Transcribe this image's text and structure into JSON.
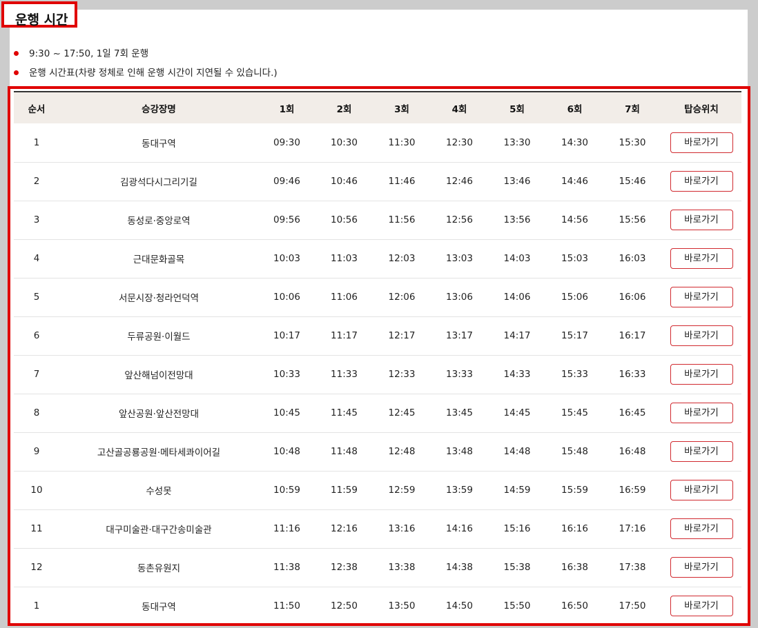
{
  "page_title": "운행 시간",
  "info": [
    "9:30 ~ 17:50, 1일 7회 운행",
    "운행 시간표(차량 정체로 인해 운행 시간이 지연될 수 있습니다.)"
  ],
  "colors": {
    "accent": "#e00000",
    "header_bg": "#f2ede8",
    "button_border": "#d0282e"
  },
  "table": {
    "headers": [
      "순서",
      "승강장명",
      "1회",
      "2회",
      "3회",
      "4회",
      "5회",
      "6회",
      "7회",
      "탑승위치"
    ],
    "button_label": "바로가기",
    "rows": [
      {
        "no": "1",
        "stop": "동대구역",
        "times": [
          "09:30",
          "10:30",
          "11:30",
          "12:30",
          "13:30",
          "14:30",
          "15:30"
        ]
      },
      {
        "no": "2",
        "stop": "김광석다시그리기길",
        "times": [
          "09:46",
          "10:46",
          "11:46",
          "12:46",
          "13:46",
          "14:46",
          "15:46"
        ]
      },
      {
        "no": "3",
        "stop": "동성로·중앙로역",
        "times": [
          "09:56",
          "10:56",
          "11:56",
          "12:56",
          "13:56",
          "14:56",
          "15:56"
        ]
      },
      {
        "no": "4",
        "stop": "근대문화골목",
        "times": [
          "10:03",
          "11:03",
          "12:03",
          "13:03",
          "14:03",
          "15:03",
          "16:03"
        ]
      },
      {
        "no": "5",
        "stop": "서문시장·청라언덕역",
        "times": [
          "10:06",
          "11:06",
          "12:06",
          "13:06",
          "14:06",
          "15:06",
          "16:06"
        ]
      },
      {
        "no": "6",
        "stop": "두류공원·이월드",
        "times": [
          "10:17",
          "11:17",
          "12:17",
          "13:17",
          "14:17",
          "15:17",
          "16:17"
        ]
      },
      {
        "no": "7",
        "stop": "앞산해넘이전망대",
        "times": [
          "10:33",
          "11:33",
          "12:33",
          "13:33",
          "14:33",
          "15:33",
          "16:33"
        ]
      },
      {
        "no": "8",
        "stop": "앞산공원·앞산전망대",
        "times": [
          "10:45",
          "11:45",
          "12:45",
          "13:45",
          "14:45",
          "15:45",
          "16:45"
        ]
      },
      {
        "no": "9",
        "stop": "고산골공룡공원·메타세콰이어길",
        "times": [
          "10:48",
          "11:48",
          "12:48",
          "13:48",
          "14:48",
          "15:48",
          "16:48"
        ]
      },
      {
        "no": "10",
        "stop": "수성못",
        "times": [
          "10:59",
          "11:59",
          "12:59",
          "13:59",
          "14:59",
          "15:59",
          "16:59"
        ]
      },
      {
        "no": "11",
        "stop": "대구미술관·대구간송미술관",
        "times": [
          "11:16",
          "12:16",
          "13:16",
          "14:16",
          "15:16",
          "16:16",
          "17:16"
        ]
      },
      {
        "no": "12",
        "stop": "동촌유원지",
        "times": [
          "11:38",
          "12:38",
          "13:38",
          "14:38",
          "15:38",
          "16:38",
          "17:38"
        ]
      },
      {
        "no": "1",
        "stop": "동대구역",
        "times": [
          "11:50",
          "12:50",
          "13:50",
          "14:50",
          "15:50",
          "16:50",
          "17:50"
        ]
      }
    ]
  }
}
